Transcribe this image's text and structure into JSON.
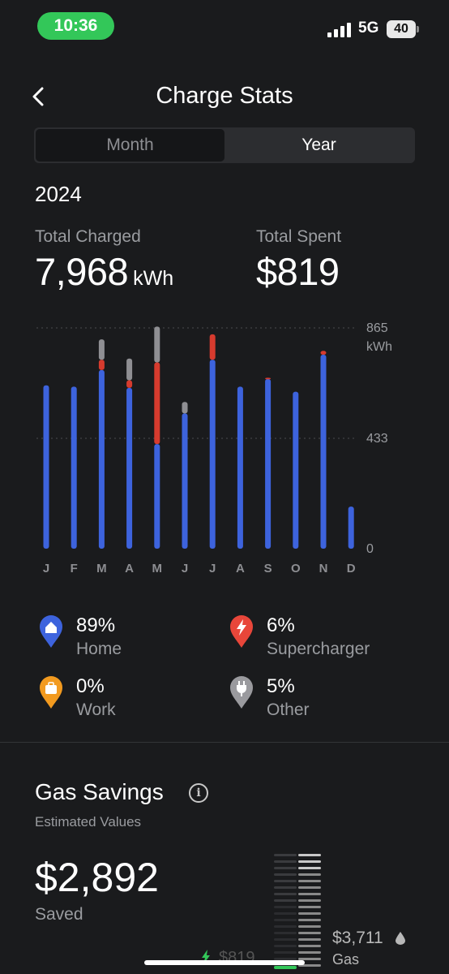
{
  "status_bar": {
    "time": "10:36",
    "network": "5G",
    "battery": "40"
  },
  "header": {
    "title": "Charge Stats"
  },
  "tabs": [
    {
      "label": "Month",
      "selected": false
    },
    {
      "label": "Year",
      "selected": true
    }
  ],
  "year": "2024",
  "totals": {
    "charged_label": "Total Charged",
    "charged_value": "7,968",
    "charged_unit": "kWh",
    "spent_label": "Total Spent",
    "spent_value": "$819"
  },
  "chart_data": {
    "type": "bar",
    "stacked": true,
    "categories": [
      "J",
      "F",
      "M",
      "A",
      "M",
      "J",
      "J",
      "A",
      "S",
      "O",
      "N",
      "D"
    ],
    "y_ticks": [
      "865",
      "433",
      "0"
    ],
    "y_unit": "kWh",
    "ylim": [
      0,
      865
    ],
    "series": [
      {
        "name": "Home",
        "color": "#3d63dd",
        "values": [
          640,
          635,
          700,
          630,
          410,
          530,
          740,
          635,
          665,
          615,
          760,
          165
        ]
      },
      {
        "name": "Supercharger",
        "color": "#d63b2e",
        "values": [
          0,
          0,
          40,
          30,
          320,
          0,
          100,
          0,
          5,
          0,
          15,
          0
        ]
      },
      {
        "name": "Work",
        "color": "#f29a1f",
        "values": [
          0,
          0,
          0,
          0,
          0,
          0,
          0,
          0,
          0,
          0,
          0,
          0
        ]
      },
      {
        "name": "Other",
        "color": "#8f8f93",
        "values": [
          0,
          0,
          80,
          85,
          140,
          45,
          0,
          0,
          0,
          0,
          0,
          0
        ]
      }
    ],
    "grid": true,
    "legend": "below"
  },
  "legend": [
    {
      "pct": "89%",
      "label": "Home",
      "icon": "home-icon",
      "color": "#3d63dd"
    },
    {
      "pct": "6%",
      "label": "Supercharger",
      "icon": "bolt-icon",
      "color": "#e8463a"
    },
    {
      "pct": "0%",
      "label": "Work",
      "icon": "briefcase-icon",
      "color": "#f29a1f"
    },
    {
      "pct": "5%",
      "label": "Other",
      "icon": "plug-icon",
      "color": "#9a9a9e"
    }
  ],
  "gas_savings": {
    "title": "Gas Savings",
    "subtitle": "Estimated Values",
    "saved_value": "$2,892",
    "saved_label": "Saved",
    "gas_cost": "$3,711",
    "gas_label": "Gas",
    "electricity_cost": "$819"
  }
}
